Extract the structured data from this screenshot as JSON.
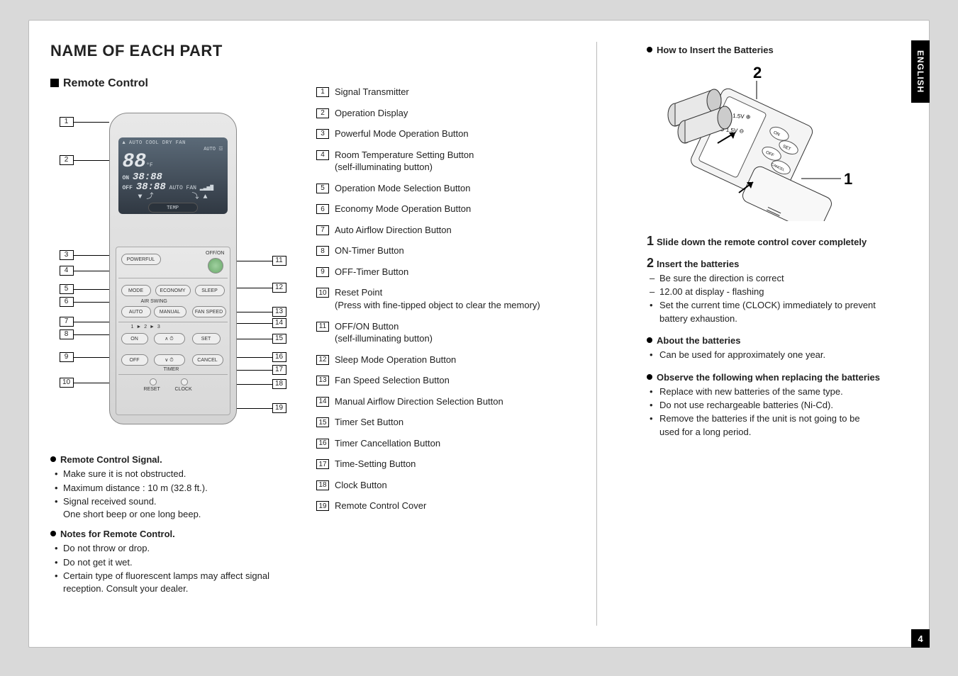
{
  "language_tab": "ENGLISH",
  "page_number": "4",
  "title": "NAME OF EACH PART",
  "section_remote": "Remote Control",
  "remote_screen": {
    "modes": "AUTO   COOL DRY FAN",
    "auto": "AUTO",
    "seg": "88",
    "unit": "°F",
    "on": "ON",
    "off": "OFF",
    "time": "38:88",
    "autofan": "AUTO FAN",
    "temp": "TEMP"
  },
  "remote_buttons": {
    "powerful": "POWERFUL",
    "offon": "OFF/ON",
    "mode": "MODE",
    "economy": "ECONOMY",
    "sleep": "SLEEP",
    "airswing": "AIR SWING",
    "auto": "AUTO",
    "manual": "MANUAL",
    "fanspeed": "FAN SPEED",
    "r123": "1     ►     2     ►     3",
    "on": "ON",
    "set": "SET",
    "off": "OFF",
    "cancel": "CANCEL",
    "timer": "TIMER",
    "reset": "RESET",
    "clock": "CLOCK"
  },
  "callouts_left": [
    "1",
    "2",
    "3",
    "4",
    "5",
    "6",
    "7",
    "8",
    "9",
    "10"
  ],
  "callouts_right": [
    "11",
    "12",
    "13",
    "14",
    "15",
    "16",
    "17",
    "18",
    "19"
  ],
  "notes": {
    "signal_head": "Remote Control Signal.",
    "signal": [
      "Make sure it is not obstructed.",
      "Maximum distance : 10 m (32.8 ft.).",
      "Signal received sound.\nOne short beep or one long beep."
    ],
    "notes_head": "Notes for Remote Control.",
    "notes": [
      "Do not throw or drop.",
      "Do not get it wet.",
      "Certain type of fluorescent lamps may affect signal reception. Consult your dealer."
    ]
  },
  "parts": [
    {
      "n": "1",
      "t": "Signal Transmitter"
    },
    {
      "n": "2",
      "t": "Operation Display"
    },
    {
      "n": "3",
      "t": "Powerful Mode Operation Button"
    },
    {
      "n": "4",
      "t": "Room Temperature Setting Button",
      "s": "(self-illuminating button)"
    },
    {
      "n": "5",
      "t": "Operation Mode Selection Button"
    },
    {
      "n": "6",
      "t": "Economy Mode Operation Button"
    },
    {
      "n": "7",
      "t": "Auto Airflow Direction Button"
    },
    {
      "n": "8",
      "t": "ON-Timer Button"
    },
    {
      "n": "9",
      "t": "OFF-Timer Button"
    },
    {
      "n": "10",
      "t": "Reset Point",
      "s": "(Press with fine-tipped object to clear the memory)"
    },
    {
      "n": "11",
      "t": "OFF/ON Button",
      "s": "(self-illuminating button)"
    },
    {
      "n": "12",
      "t": "Sleep Mode Operation Button"
    },
    {
      "n": "13",
      "t": "Fan Speed Selection Button"
    },
    {
      "n": "14",
      "t": "Manual Airflow Direction Selection Button"
    },
    {
      "n": "15",
      "t": "Timer Set Button"
    },
    {
      "n": "16",
      "t": "Timer Cancellation Button"
    },
    {
      "n": "17",
      "t": "Time-Setting Button"
    },
    {
      "n": "18",
      "t": "Clock Button"
    },
    {
      "n": "19",
      "t": "Remote Control Cover"
    }
  ],
  "right": {
    "howto": "How  to Insert the Batteries",
    "fig_labels": {
      "one": "1",
      "two": "2",
      "on": "ON",
      "off": "OFF",
      "set": "SET",
      "cancel": "CANCEL",
      "v": "1.5V"
    },
    "step1": "Slide down the remote control cover completely",
    "step2_head": "Insert the batteries",
    "step2_items_dash": [
      "Be sure the direction is correct",
      "12.00 at display - flashing"
    ],
    "step2_items_bul": [
      "Set the current time (CLOCK) immediately to prevent battery exhaustion."
    ],
    "about_head": "About the batteries",
    "about_items": [
      "Can be used for approximately one year."
    ],
    "observe_head": "Observe the following when replacing the batteries",
    "observe_items": [
      "Replace with new batteries of the same type.",
      "Do not use rechargeable batteries (Ni-Cd).",
      "Remove the batteries if the unit is not going to be used for a long period."
    ]
  }
}
